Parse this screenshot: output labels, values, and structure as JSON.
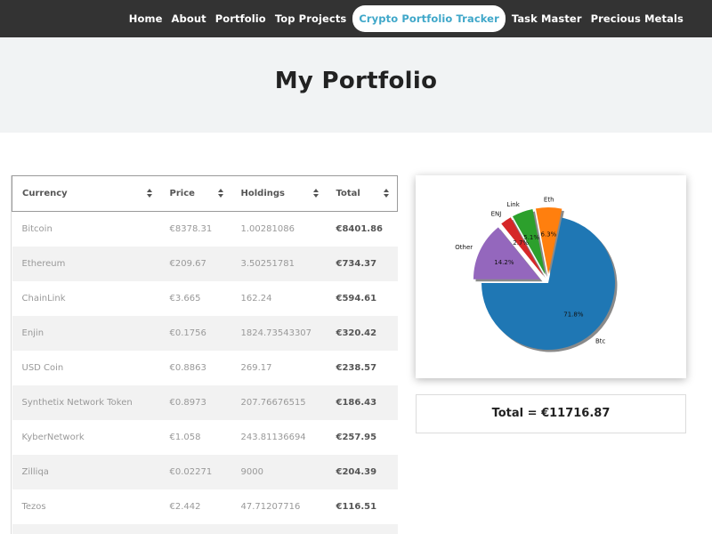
{
  "nav": {
    "items": [
      {
        "label": "Home",
        "active": false
      },
      {
        "label": "About",
        "active": false
      },
      {
        "label": "Portfolio",
        "active": false
      },
      {
        "label": "Top Projects",
        "active": false
      },
      {
        "label": "Crypto Portfolio Tracker",
        "active": true
      },
      {
        "label": "Task Master",
        "active": false
      },
      {
        "label": "Precious Metals",
        "active": false
      }
    ]
  },
  "hero": {
    "title": "My Portfolio"
  },
  "table": {
    "headers": [
      "Currency",
      "Price",
      "Holdings",
      "Total"
    ],
    "rows": [
      {
        "currency": "Bitcoin",
        "price": "€8378.31",
        "holdings": "1.00281086",
        "total": "€8401.86"
      },
      {
        "currency": "Ethereum",
        "price": "€209.67",
        "holdings": "3.50251781",
        "total": "€734.37"
      },
      {
        "currency": "ChainLink",
        "price": "€3.665",
        "holdings": "162.24",
        "total": "€594.61"
      },
      {
        "currency": "Enjin",
        "price": "€0.1756",
        "holdings": "1824.73543307",
        "total": "€320.42"
      },
      {
        "currency": "USD Coin",
        "price": "€0.8863",
        "holdings": "269.17",
        "total": "€238.57"
      },
      {
        "currency": "Synthetix Network Token",
        "price": "€0.8973",
        "holdings": "207.76676515",
        "total": "€186.43"
      },
      {
        "currency": "KyberNetwork",
        "price": "€1.058",
        "holdings": "243.81136694",
        "total": "€257.95"
      },
      {
        "currency": "Zilliqa",
        "price": "€0.02271",
        "holdings": "9000",
        "total": "€204.39"
      },
      {
        "currency": "Tezos",
        "price": "€2.442",
        "holdings": "47.71207716",
        "total": "€116.51"
      },
      {
        "currency": "",
        "price": "",
        "holdings": "",
        "total": ""
      }
    ]
  },
  "chart_data": {
    "type": "pie",
    "title": "",
    "slices": [
      {
        "label": "Btc",
        "value": 71.8,
        "pct_label": "71.8%",
        "color": "#1f77b4"
      },
      {
        "label": "Eth",
        "value": 6.3,
        "pct_label": "6.3%",
        "color": "#ff7f0e"
      },
      {
        "label": "Link",
        "value": 5.1,
        "pct_label": "5.1%",
        "color": "#2ca02c"
      },
      {
        "label": "ENJ",
        "value": 2.7,
        "pct_label": "2.7%",
        "color": "#d62728"
      },
      {
        "label": "Other",
        "value": 14.2,
        "pct_label": "14.2%",
        "color": "#9467bd"
      }
    ],
    "exploded": true,
    "shadow": true
  },
  "summary": {
    "total_text": "Total = €11716.87"
  }
}
